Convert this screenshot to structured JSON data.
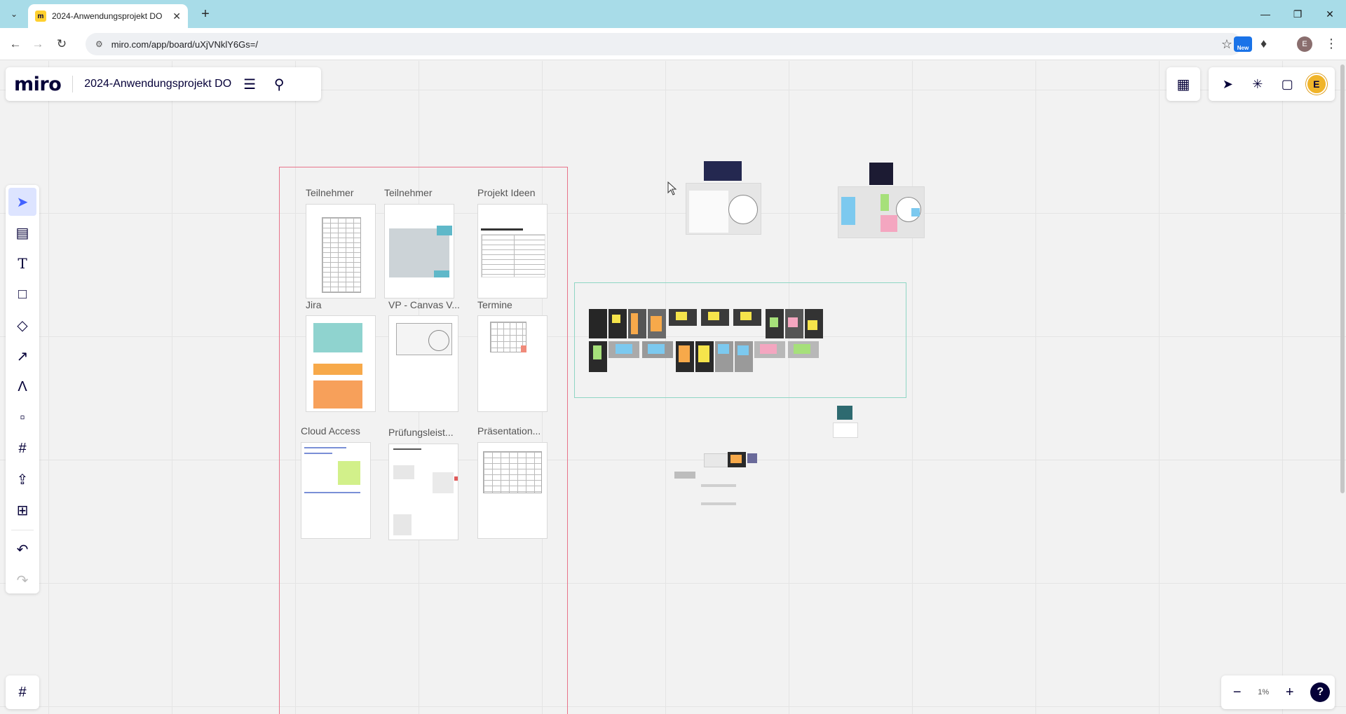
{
  "browser": {
    "tab_title": "2024-Anwendungsprojekt DO",
    "tab_favicon": "miro-favicon",
    "url": "miro.com/app/board/uXjVNklY6Gs=/",
    "ext_new_label": "New",
    "profile_initial": "E"
  },
  "header": {
    "logo": "miro",
    "board_title": "2024-Anwendungsprojekt DO"
  },
  "user": {
    "avatar_initial": "E"
  },
  "frame_cards": [
    {
      "label": "Teilnehmer"
    },
    {
      "label": "Teilnehmer"
    },
    {
      "label": "Projekt Ideen"
    },
    {
      "label": "Jira"
    },
    {
      "label": "VP - Canvas V..."
    },
    {
      "label": "Termine"
    },
    {
      "label": "Cloud Access"
    },
    {
      "label": "Prüfungsleist..."
    },
    {
      "label": "Präsentation..."
    }
  ],
  "zoom": {
    "level": "1%"
  },
  "help_label": "?",
  "colors": {
    "accent": "#4262ff",
    "miro_dark": "#050038",
    "frame_red": "#e8748a",
    "frame_green": "#8fd6c4",
    "tab_strip": "#a8dce8"
  }
}
